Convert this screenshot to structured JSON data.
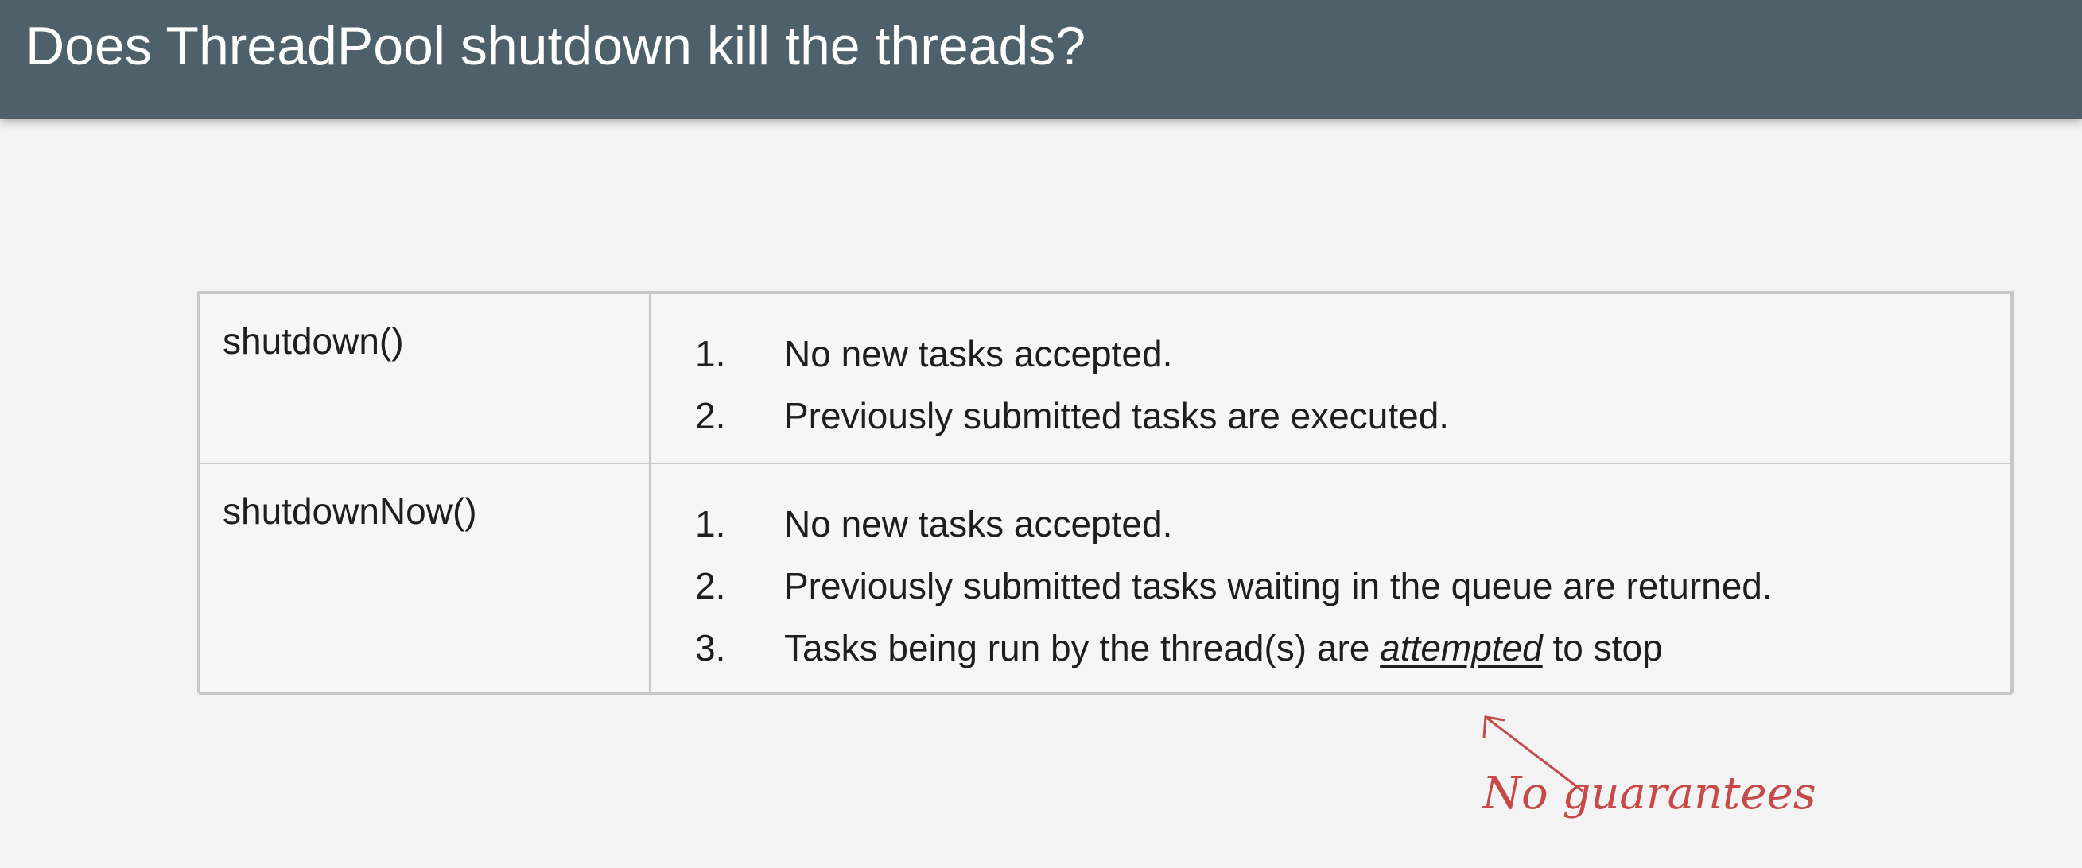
{
  "slide": {
    "title": "Does ThreadPool shutdown kill the threads?"
  },
  "table": {
    "rows": [
      {
        "method": "shutdown()",
        "items": [
          {
            "number": "1.",
            "text": "No new tasks accepted."
          },
          {
            "number": "2.",
            "text": "Previously submitted tasks are executed."
          }
        ]
      },
      {
        "method": "shutdownNow()",
        "items": [
          {
            "number": "1.",
            "text": "No new tasks accepted."
          },
          {
            "number": "2.",
            "text": "Previously submitted tasks waiting in the queue are returned."
          },
          {
            "number": "3.",
            "text_before": "Tasks being run by the thread(s) are ",
            "emphasis": "attempted",
            "text_after": " to stop"
          }
        ]
      }
    ]
  },
  "annotation": {
    "text": "No guarantees",
    "color": "#c64a4a"
  },
  "colors": {
    "header_bg": "#4e6069",
    "slide_bg": "#f3f3f3",
    "border": "#c8c8c8"
  }
}
